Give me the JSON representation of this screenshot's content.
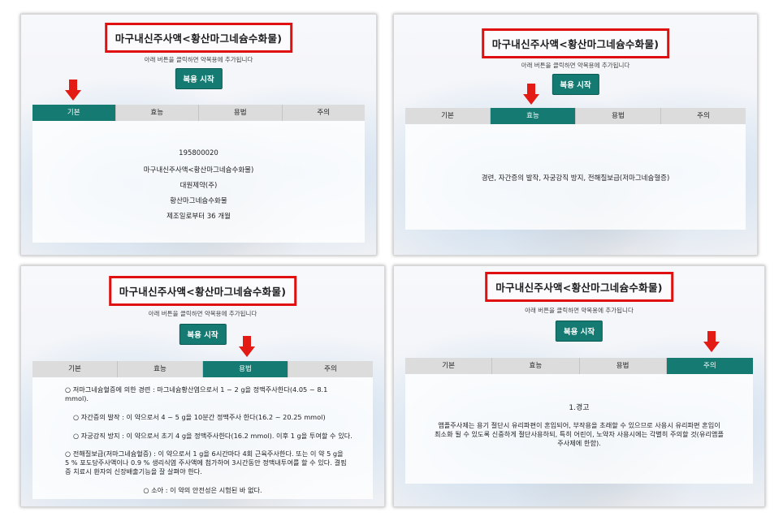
{
  "title": "마구내신주사액<황산마그네슘수화물)",
  "subtitle": "아래 버튼을 클릭하면 약복용에 추가됩니다",
  "start_button": "복용 시작",
  "tabs": [
    "기본",
    "효능",
    "용법",
    "주의"
  ],
  "basic": {
    "code": "195800020",
    "name": "마구내신주사액<황산마그네슘수화물)",
    "maker": "대원제약(주)",
    "ingredient": "황산마그네슘수화물",
    "expiry": "제조일로부터 36 개월"
  },
  "efficacy": {
    "text": "경련, 자간증의 발작, 자궁강직 방지, 전해질보급(저마그네슘혈증)"
  },
  "usage": {
    "items": [
      "○ 저마그네슘혈증에 의한 경련 : 마그네슘황산염으로서 1 ~ 2 g을 정맥주사한다(4.05 ~ 8.1 mmol).",
      "○ 자간증의 발작 : 이 약으로서 4 ~ 5 g을 10분간 정맥주사 한다(16.2 ~ 20.25 mmol)",
      "○ 자궁강직 방지 : 이 약으로서 초기 4 g을 정맥주사한다(16.2 mmol). 이후 1 g을 투여할 수 있다.",
      "○ 전해질보급(저마그네슘혈증) : 이 약으로서 1 g을 6시간마다 4회 근육주사한다. 또는 이 약 5 g을 5 % 포도당주사액이나 0.9 % 생리식염 주사액에 첨가하여 3시간동안 정맥내투여를 할 수 있다. 결핍증 치료시 환자의 신장배출기능을 잘 살펴야 한다.",
      "○ 소아 : 이 약의 안전성은 시험된 바 없다."
    ]
  },
  "caution": {
    "heading": "1.경고",
    "text": "앰플주사제는 용기 절단시 유리파편이 혼입되어, 부작용을 초래할 수 있으므로 사용시 유리파편 혼입이 최소화 될 수 있도록 신중하게 절단사용하되, 특히 어린이, 노약자 사용시에는 각별히 주의할 것(유리앰플주사제에 한함)."
  },
  "accent_color": "#147a72",
  "highlight_color": "#e41b14"
}
